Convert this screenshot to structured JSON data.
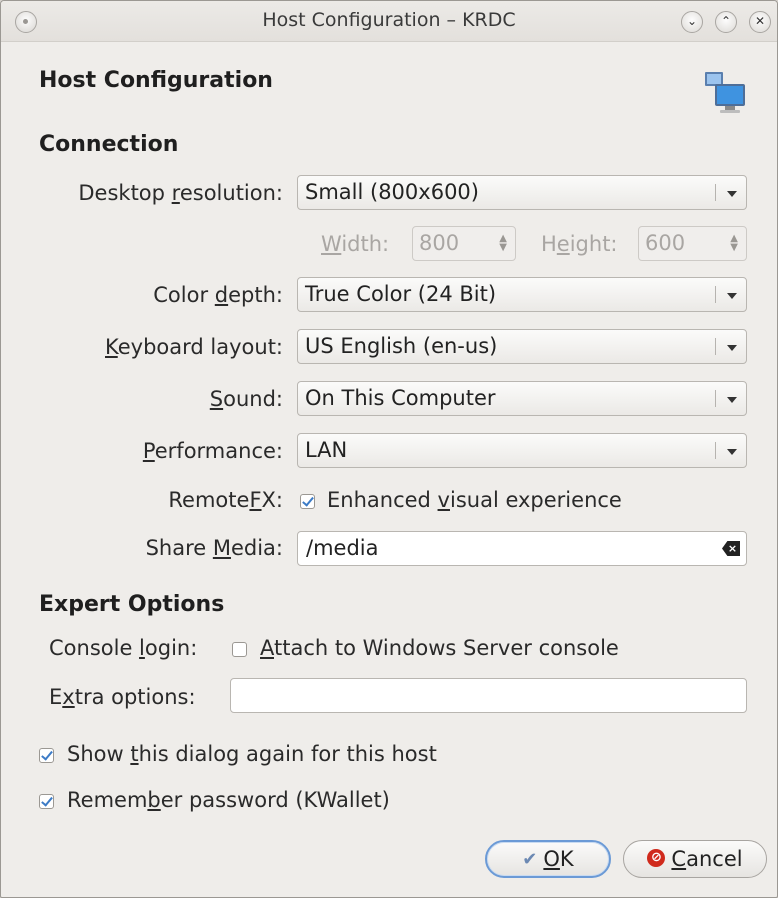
{
  "window": {
    "title": "Host Configuration – KRDC"
  },
  "header": {
    "title": "Host Configuration",
    "icon": "remote-desktop-icon"
  },
  "connection": {
    "heading": "Connection",
    "resolution": {
      "label_pre": "Desktop ",
      "label_u": "r",
      "label_post": "esolution:",
      "value": "Small (800x600)"
    },
    "width": {
      "label_pre": "",
      "label_u": "W",
      "label_post": "idth:",
      "value": "800"
    },
    "height": {
      "label_pre": "H",
      "label_u": "e",
      "label_post": "ight:",
      "value": "600"
    },
    "color_depth": {
      "label_pre": "Color ",
      "label_u": "d",
      "label_post": "epth:",
      "value": "True Color (24 Bit)"
    },
    "keyboard": {
      "label_pre": "",
      "label_u": "K",
      "label_post": "eyboard layout:",
      "value": "US English (en-us)"
    },
    "sound": {
      "label_pre": "",
      "label_u": "S",
      "label_post": "ound:",
      "value": "On This Computer"
    },
    "performance": {
      "label_pre": "",
      "label_u": "P",
      "label_post": "erformance:",
      "value": "LAN"
    },
    "remotefx": {
      "label_pre": "Remote",
      "label_u": "F",
      "label_post": "X:",
      "checkbox_pre": "Enhanced ",
      "checkbox_u": "v",
      "checkbox_post": "isual experience",
      "checked": true
    },
    "share_media": {
      "label_pre": "Share ",
      "label_u": "M",
      "label_post": "edia:",
      "value": "/media"
    }
  },
  "expert": {
    "heading": "Expert Options",
    "console_login": {
      "label_pre": "Console ",
      "label_u": "l",
      "label_post": "ogin:",
      "checkbox_pre": "",
      "checkbox_u": "A",
      "checkbox_post": "ttach to Windows Server console",
      "checked": false
    },
    "extra_options": {
      "label_pre": "E",
      "label_u": "x",
      "label_post": "tra options:",
      "value": ""
    }
  },
  "footer": {
    "show_again": {
      "pre": "Show ",
      "u": "t",
      "post": "his dialog again for this host",
      "checked": true
    },
    "remember": {
      "pre": "Remem",
      "u": "b",
      "post": "er password (KWallet)",
      "checked": true
    },
    "ok": {
      "pre": "",
      "u": "O",
      "post": "K"
    },
    "cancel": {
      "pre": "",
      "u": "C",
      "post": "ancel"
    }
  },
  "colors": {
    "accent": "#3c7bc6",
    "cancel_red": "#d02a1c",
    "background": "#efedea"
  }
}
